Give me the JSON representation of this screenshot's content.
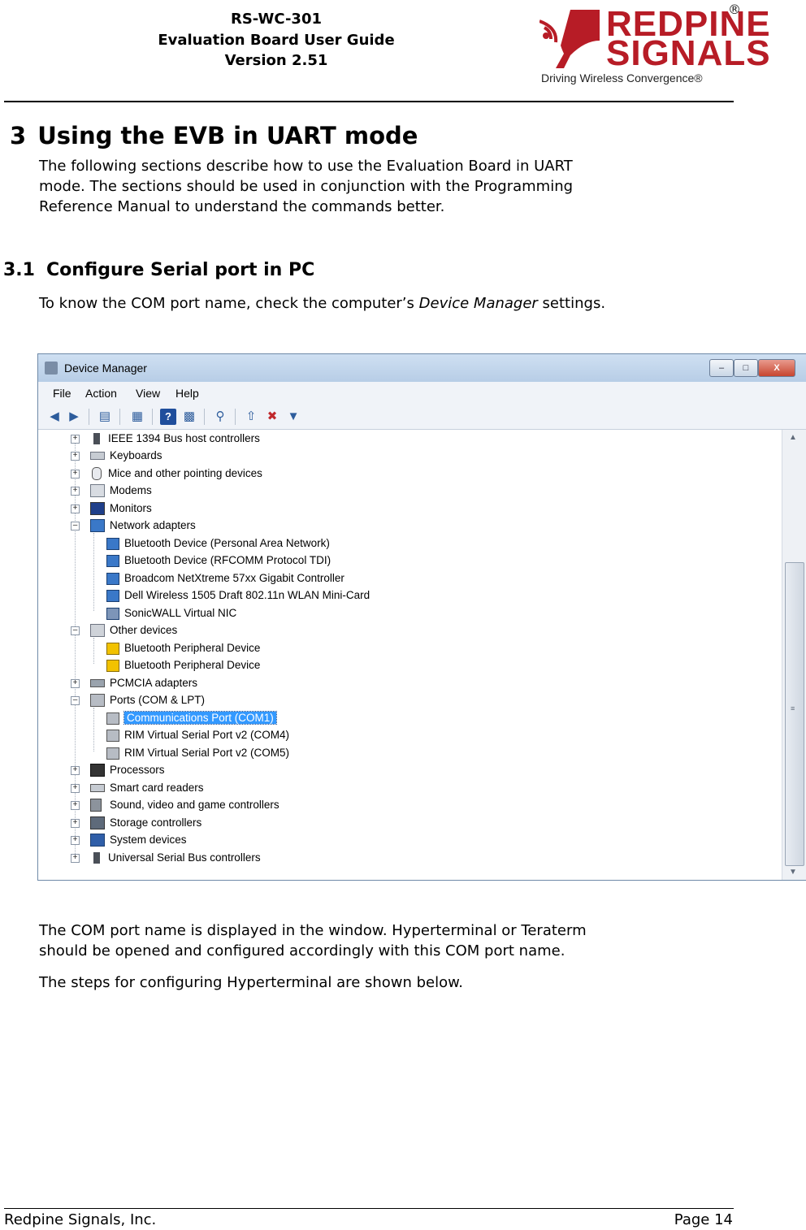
{
  "header": {
    "product": "RS-WC-301",
    "doc_title": "Evaluation Board User Guide",
    "version": "Version 2.51",
    "logo_line1": "REDPINE",
    "logo_line2": "SIGNALS",
    "logo_tagline": "Driving Wireless Convergence®",
    "logo_registered": "®"
  },
  "section": {
    "number": "3",
    "title": "Using the EVB in UART mode",
    "intro_line1": "The following sections describe how to use the Evaluation Board in UART",
    "intro_line2": "mode. The sections should be used in conjunction with the Programming",
    "intro_line3": "Reference Manual to understand the commands better."
  },
  "subsection": {
    "number": "3.1",
    "title": "Configure Serial port in PC",
    "text_before": "To know the COM port name, check the computer’s ",
    "text_italic": "Device Manager",
    "text_after": " settings."
  },
  "device_manager": {
    "title": "Device Manager",
    "window_buttons": [
      "–",
      "□",
      "X"
    ],
    "menu": [
      "File",
      "Action",
      "View",
      "Help"
    ],
    "tree": [
      {
        "label": "IEEE 1394 Bus host controllers",
        "level": 0,
        "expanded": false,
        "icon": "usb-plug-icon"
      },
      {
        "label": "Keyboards",
        "level": 0,
        "expanded": false,
        "icon": "keyboard-icon"
      },
      {
        "label": "Mice and other pointing devices",
        "level": 0,
        "expanded": false,
        "icon": "mouse-icon"
      },
      {
        "label": "Modems",
        "level": 0,
        "expanded": false,
        "icon": "modem-icon"
      },
      {
        "label": "Monitors",
        "level": 0,
        "expanded": false,
        "icon": "monitor-icon"
      },
      {
        "label": "Network adapters",
        "level": 0,
        "expanded": true,
        "icon": "network-icon"
      },
      {
        "label": "Bluetooth Device (Personal Area Network)",
        "level": 1,
        "icon": "network-icon"
      },
      {
        "label": "Bluetooth Device (RFCOMM Protocol TDI)",
        "level": 1,
        "icon": "network-icon"
      },
      {
        "label": "Broadcom NetXtreme 57xx Gigabit Controller",
        "level": 1,
        "icon": "network-icon"
      },
      {
        "label": "Dell Wireless 1505 Draft 802.11n WLAN Mini-Card",
        "level": 1,
        "icon": "network-icon"
      },
      {
        "label": "SonicWALL Virtual NIC",
        "level": 1,
        "icon": "network-disabled-icon"
      },
      {
        "label": "Other devices",
        "level": 0,
        "expanded": true,
        "icon": "unknown-device-icon"
      },
      {
        "label": "Bluetooth Peripheral Device",
        "level": 1,
        "icon": "warning-device-icon"
      },
      {
        "label": "Bluetooth Peripheral Device",
        "level": 1,
        "icon": "warning-device-icon"
      },
      {
        "label": "PCMCIA adapters",
        "level": 0,
        "expanded": false,
        "icon": "pcmcia-icon"
      },
      {
        "label": "Ports (COM & LPT)",
        "level": 0,
        "expanded": true,
        "icon": "port-icon"
      },
      {
        "label": "Communications Port (COM1)",
        "level": 1,
        "icon": "port-icon",
        "selected": true
      },
      {
        "label": "RIM Virtual Serial Port v2 (COM4)",
        "level": 1,
        "icon": "port-icon"
      },
      {
        "label": "RIM Virtual Serial Port v2 (COM5)",
        "level": 1,
        "icon": "port-icon"
      },
      {
        "label": "Processors",
        "level": 0,
        "expanded": false,
        "icon": "processor-icon"
      },
      {
        "label": "Smart card readers",
        "level": 0,
        "expanded": false,
        "icon": "smart-card-icon"
      },
      {
        "label": "Sound, video and game controllers",
        "level": 0,
        "expanded": false,
        "icon": "speaker-icon"
      },
      {
        "label": "Storage controllers",
        "level": 0,
        "expanded": false,
        "icon": "storage-icon"
      },
      {
        "label": "System devices",
        "level": 0,
        "expanded": false,
        "icon": "system-icon"
      },
      {
        "label": "Universal Serial Bus controllers",
        "level": 0,
        "expanded": false,
        "icon": "usb-plug-icon"
      }
    ]
  },
  "after_figure": {
    "line1": "The COM port name is displayed in the window. Hyperterminal or Teraterm",
    "line2": "should be opened and configured accordingly with this COM port name.",
    "line3": "The steps for configuring Hyperterminal are shown below."
  },
  "footer": {
    "company": "Redpine Signals, Inc.",
    "page": "Page 14"
  },
  "colors": {
    "brand_red": "#b71c26",
    "selection_blue": "#3399ff",
    "titlebar_blue": "#c3d6ec"
  }
}
